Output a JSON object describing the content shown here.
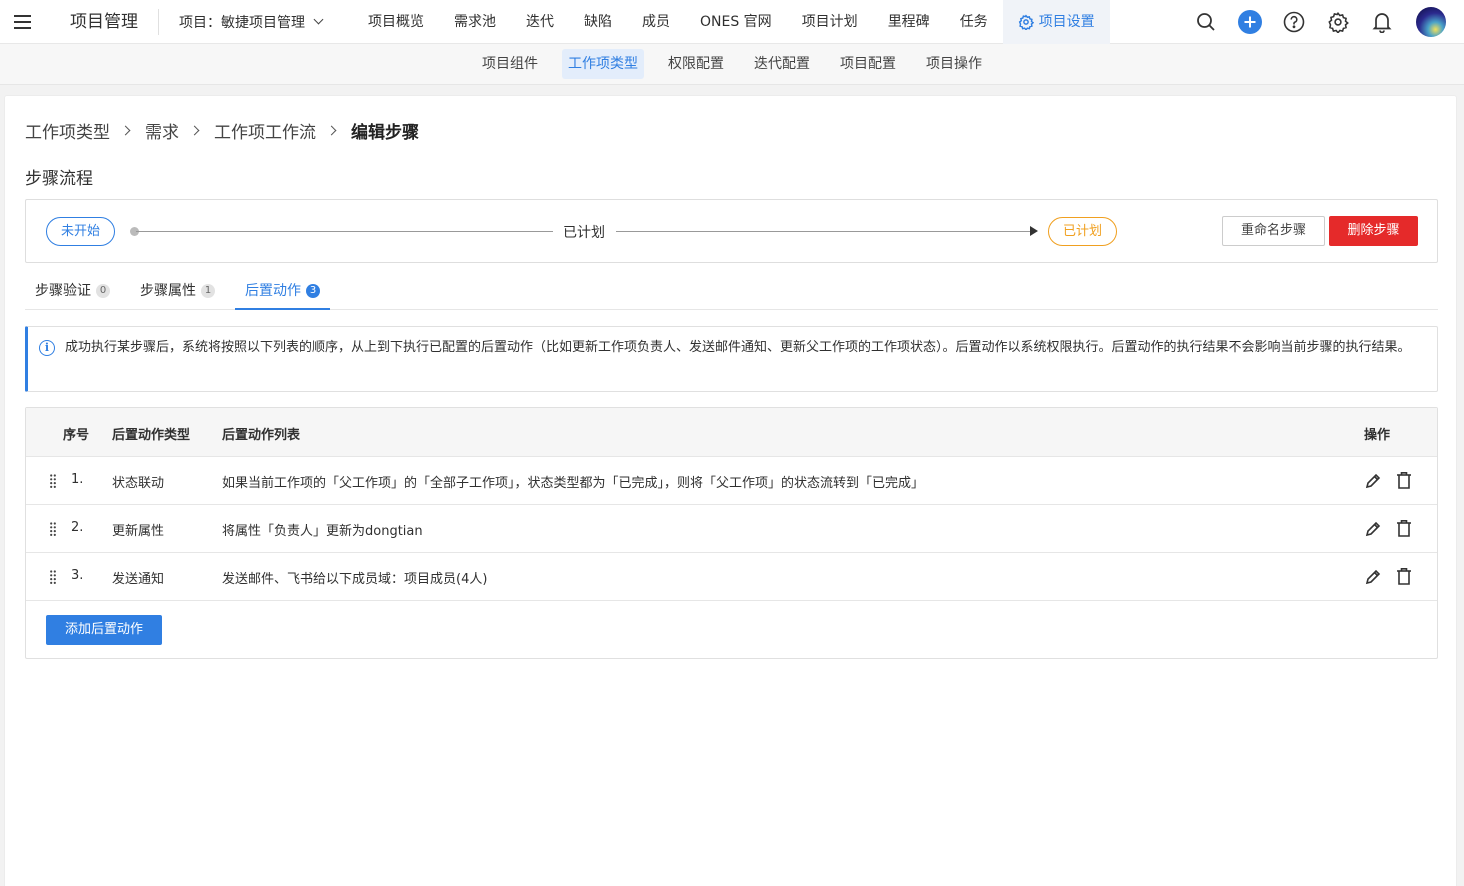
{
  "header": {
    "app_title": "项目管理",
    "project_switch": "项目：敏捷项目管理",
    "nav": [
      "项目概览",
      "需求池",
      "迭代",
      "缺陷",
      "成员",
      "ONES 官网",
      "项目计划",
      "里程碑",
      "任务"
    ],
    "active_nav": "项目设置",
    "accent_color": "#307fe2"
  },
  "subnav": {
    "items": [
      "项目组件",
      "工作项类型",
      "权限配置",
      "迭代配置",
      "项目配置",
      "项目操作"
    ],
    "active_index": 1
  },
  "breadcrumb": [
    "工作项类型",
    "需求",
    "工作项工作流",
    "编辑步骤"
  ],
  "section_title": "步骤流程",
  "flow": {
    "from": "未开始",
    "step": "已计划",
    "to": "已计划",
    "rename_label": "重命名步骤",
    "delete_label": "删除步骤"
  },
  "tabs": [
    {
      "label": "步骤验证",
      "count": "0"
    },
    {
      "label": "步骤属性",
      "count": "1"
    },
    {
      "label": "后置动作",
      "count": "3"
    }
  ],
  "active_tab": 2,
  "info": "成功执行某步骤后，系统将按照以下列表的顺序，从上到下执行已配置的后置动作（比如更新工作项负责人、发送邮件通知、更新父工作项的工作项状态）。后置动作以系统权限执行。后置动作的执行结果不会影响当前步骤的执行结果。",
  "table": {
    "headers": {
      "index": "序号",
      "type": "后置动作类型",
      "list": "后置动作列表",
      "ops": "操作"
    },
    "rows": [
      {
        "index": "1.",
        "type": "状态联动",
        "desc": "如果当前工作项的「父工作项」的「全部子工作项」，状态类型都为「已完成」，则将「父工作项」的状态流转到「已完成」"
      },
      {
        "index": "2.",
        "type": "更新属性",
        "desc": "将属性「负责人」更新为dongtian"
      },
      {
        "index": "3.",
        "type": "发送通知",
        "desc": "发送邮件、飞书给以下成员域：项目成员(4人)"
      }
    ],
    "add_label": "添加后置动作"
  }
}
